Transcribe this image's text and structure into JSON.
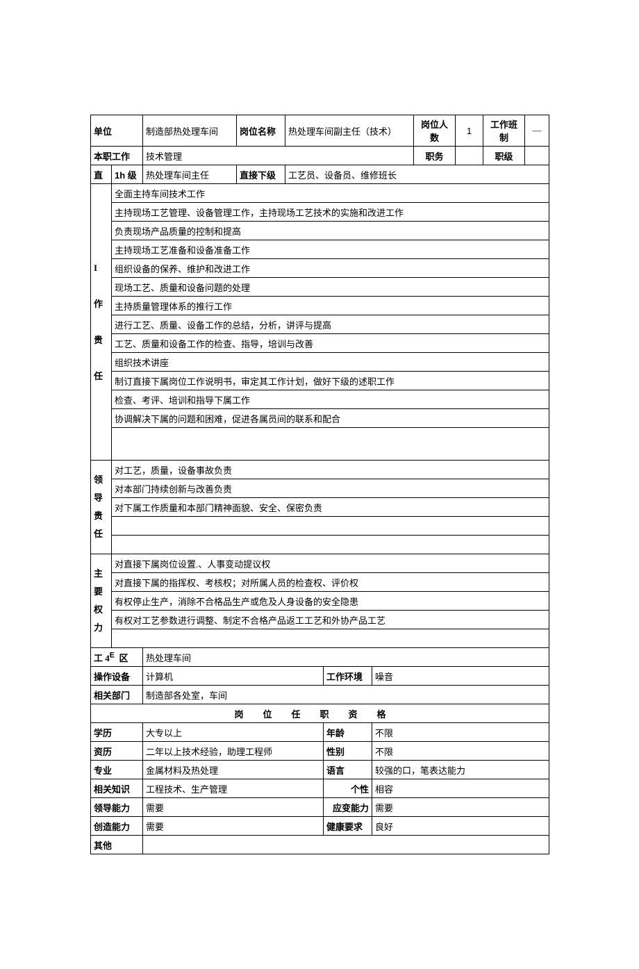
{
  "header": {
    "unit_label": "单位",
    "unit_value": "制造部热处理车间",
    "position_name_label": "岗位名称",
    "position_name_value": "热处理车间副主任（技术）",
    "headcount_label": "岗位人数",
    "headcount_value": "1",
    "shift_label": "工作班制",
    "shift_value": "—"
  },
  "row2": {
    "main_job_label": "本职工作",
    "main_job_value": "技术管理",
    "duty_label": "职务",
    "duty_value": "",
    "rank_label": "职级",
    "rank_value": ""
  },
  "row3": {
    "direct_label": "直",
    "level_label": "1h 级",
    "superior_value": "热处理车间主任",
    "sub_label": "直接下级",
    "sub_value": "工艺员、设备员、维修班长"
  },
  "duties": {
    "section_label": "I\n\n作\n\n贵\n\n任",
    "items": [
      "全面主持车间技术工作",
      "主持现场工艺管理、设备管理工作，主持现场工艺技术的实施和改进工作",
      "负责现场产品质量的控制和提高",
      "主持现场工艺准备和设备准备工作",
      "组织设备的保养、维护和改进工作",
      "现场工艺、质量和设备问题的处理",
      "主持质量管理体系的推行工作",
      "进行工艺、质量、设备工作的总结，分析，讲评与提高",
      "工艺、质量和设备工作的检查、指导，培训与改善",
      "组织技术讲座",
      "制订直接下属岗位工作说明书，审定其工作计划，做好下级的述职工作",
      "检查、考评、培训和指导下属工作",
      "协调解决下属的问题和困难，促进各属员间的联系和配合"
    ]
  },
  "leadership": {
    "section_label": "领导贵任",
    "items": [
      "对工艺，质量，设备事故负责",
      "对本部门持续创新与改善负责",
      "对下属工作质量和本部门精神面貌、安全、保密负责"
    ]
  },
  "authority": {
    "section_label": "主要权力",
    "items": [
      "对直接下属岗位设置.、人事变动提议权",
      "对直接下属的指挥权、考核权；对所属人员的检查权、评价权",
      "有权停止生产，消除不合格品生产或危及人身设备的安全隐患",
      "有权对工艺参数进行调整、制定不合格产品返工工艺和外协产品工艺"
    ]
  },
  "workarea": {
    "label_prefix": "工 4",
    "label_e": "E",
    "label_suffix": "区",
    "value": "热处理车间"
  },
  "equipment": {
    "label": "操作设备",
    "value": "计算机",
    "env_label": "工作环境",
    "env_value": "噪音"
  },
  "related_dept": {
    "label": "相关部门",
    "value": "制造部各处室，车间"
  },
  "qual_header": "岗位任职资格",
  "qual": {
    "edu_label": "学历",
    "edu_value": "大专以上",
    "age_label": "年龄",
    "age_value": "不限",
    "exp_label": "资历",
    "exp_value": "二年以上技术经验，助理工程师",
    "gender_label": "性别",
    "gender_value": "不限",
    "major_label": "专业",
    "major_value": "金属材料及热处理",
    "lang_label": "语言",
    "lang_value": "较强的口，笔表达能力",
    "knowledge_label": "相关知识",
    "knowledge_value": "工程技术、生产管理",
    "personality_label": "个性",
    "personality_value": "相容",
    "leadership_label": "领导能力",
    "leadership_value": "需要",
    "adapt_label": "应变能力",
    "adapt_value": "需要",
    "creative_label": "创造能力",
    "creative_value": "需要",
    "health_label": "健康要求",
    "health_value": "良好",
    "other_label": "其他",
    "other_value": ""
  }
}
